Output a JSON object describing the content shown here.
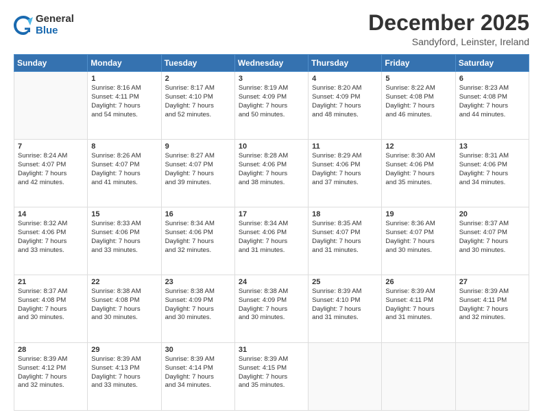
{
  "logo": {
    "general": "General",
    "blue": "Blue"
  },
  "header": {
    "month": "December 2025",
    "location": "Sandyford, Leinster, Ireland"
  },
  "days_of_week": [
    "Sunday",
    "Monday",
    "Tuesday",
    "Wednesday",
    "Thursday",
    "Friday",
    "Saturday"
  ],
  "weeks": [
    [
      {
        "day": "",
        "info": ""
      },
      {
        "day": "1",
        "info": "Sunrise: 8:16 AM\nSunset: 4:11 PM\nDaylight: 7 hours\nand 54 minutes."
      },
      {
        "day": "2",
        "info": "Sunrise: 8:17 AM\nSunset: 4:10 PM\nDaylight: 7 hours\nand 52 minutes."
      },
      {
        "day": "3",
        "info": "Sunrise: 8:19 AM\nSunset: 4:09 PM\nDaylight: 7 hours\nand 50 minutes."
      },
      {
        "day": "4",
        "info": "Sunrise: 8:20 AM\nSunset: 4:09 PM\nDaylight: 7 hours\nand 48 minutes."
      },
      {
        "day": "5",
        "info": "Sunrise: 8:22 AM\nSunset: 4:08 PM\nDaylight: 7 hours\nand 46 minutes."
      },
      {
        "day": "6",
        "info": "Sunrise: 8:23 AM\nSunset: 4:08 PM\nDaylight: 7 hours\nand 44 minutes."
      }
    ],
    [
      {
        "day": "7",
        "info": "Sunrise: 8:24 AM\nSunset: 4:07 PM\nDaylight: 7 hours\nand 42 minutes."
      },
      {
        "day": "8",
        "info": "Sunrise: 8:26 AM\nSunset: 4:07 PM\nDaylight: 7 hours\nand 41 minutes."
      },
      {
        "day": "9",
        "info": "Sunrise: 8:27 AM\nSunset: 4:07 PM\nDaylight: 7 hours\nand 39 minutes."
      },
      {
        "day": "10",
        "info": "Sunrise: 8:28 AM\nSunset: 4:06 PM\nDaylight: 7 hours\nand 38 minutes."
      },
      {
        "day": "11",
        "info": "Sunrise: 8:29 AM\nSunset: 4:06 PM\nDaylight: 7 hours\nand 37 minutes."
      },
      {
        "day": "12",
        "info": "Sunrise: 8:30 AM\nSunset: 4:06 PM\nDaylight: 7 hours\nand 35 minutes."
      },
      {
        "day": "13",
        "info": "Sunrise: 8:31 AM\nSunset: 4:06 PM\nDaylight: 7 hours\nand 34 minutes."
      }
    ],
    [
      {
        "day": "14",
        "info": "Sunrise: 8:32 AM\nSunset: 4:06 PM\nDaylight: 7 hours\nand 33 minutes."
      },
      {
        "day": "15",
        "info": "Sunrise: 8:33 AM\nSunset: 4:06 PM\nDaylight: 7 hours\nand 33 minutes."
      },
      {
        "day": "16",
        "info": "Sunrise: 8:34 AM\nSunset: 4:06 PM\nDaylight: 7 hours\nand 32 minutes."
      },
      {
        "day": "17",
        "info": "Sunrise: 8:34 AM\nSunset: 4:06 PM\nDaylight: 7 hours\nand 31 minutes."
      },
      {
        "day": "18",
        "info": "Sunrise: 8:35 AM\nSunset: 4:07 PM\nDaylight: 7 hours\nand 31 minutes."
      },
      {
        "day": "19",
        "info": "Sunrise: 8:36 AM\nSunset: 4:07 PM\nDaylight: 7 hours\nand 30 minutes."
      },
      {
        "day": "20",
        "info": "Sunrise: 8:37 AM\nSunset: 4:07 PM\nDaylight: 7 hours\nand 30 minutes."
      }
    ],
    [
      {
        "day": "21",
        "info": "Sunrise: 8:37 AM\nSunset: 4:08 PM\nDaylight: 7 hours\nand 30 minutes."
      },
      {
        "day": "22",
        "info": "Sunrise: 8:38 AM\nSunset: 4:08 PM\nDaylight: 7 hours\nand 30 minutes."
      },
      {
        "day": "23",
        "info": "Sunrise: 8:38 AM\nSunset: 4:09 PM\nDaylight: 7 hours\nand 30 minutes."
      },
      {
        "day": "24",
        "info": "Sunrise: 8:38 AM\nSunset: 4:09 PM\nDaylight: 7 hours\nand 30 minutes."
      },
      {
        "day": "25",
        "info": "Sunrise: 8:39 AM\nSunset: 4:10 PM\nDaylight: 7 hours\nand 31 minutes."
      },
      {
        "day": "26",
        "info": "Sunrise: 8:39 AM\nSunset: 4:11 PM\nDaylight: 7 hours\nand 31 minutes."
      },
      {
        "day": "27",
        "info": "Sunrise: 8:39 AM\nSunset: 4:11 PM\nDaylight: 7 hours\nand 32 minutes."
      }
    ],
    [
      {
        "day": "28",
        "info": "Sunrise: 8:39 AM\nSunset: 4:12 PM\nDaylight: 7 hours\nand 32 minutes."
      },
      {
        "day": "29",
        "info": "Sunrise: 8:39 AM\nSunset: 4:13 PM\nDaylight: 7 hours\nand 33 minutes."
      },
      {
        "day": "30",
        "info": "Sunrise: 8:39 AM\nSunset: 4:14 PM\nDaylight: 7 hours\nand 34 minutes."
      },
      {
        "day": "31",
        "info": "Sunrise: 8:39 AM\nSunset: 4:15 PM\nDaylight: 7 hours\nand 35 minutes."
      },
      {
        "day": "",
        "info": ""
      },
      {
        "day": "",
        "info": ""
      },
      {
        "day": "",
        "info": ""
      }
    ]
  ]
}
